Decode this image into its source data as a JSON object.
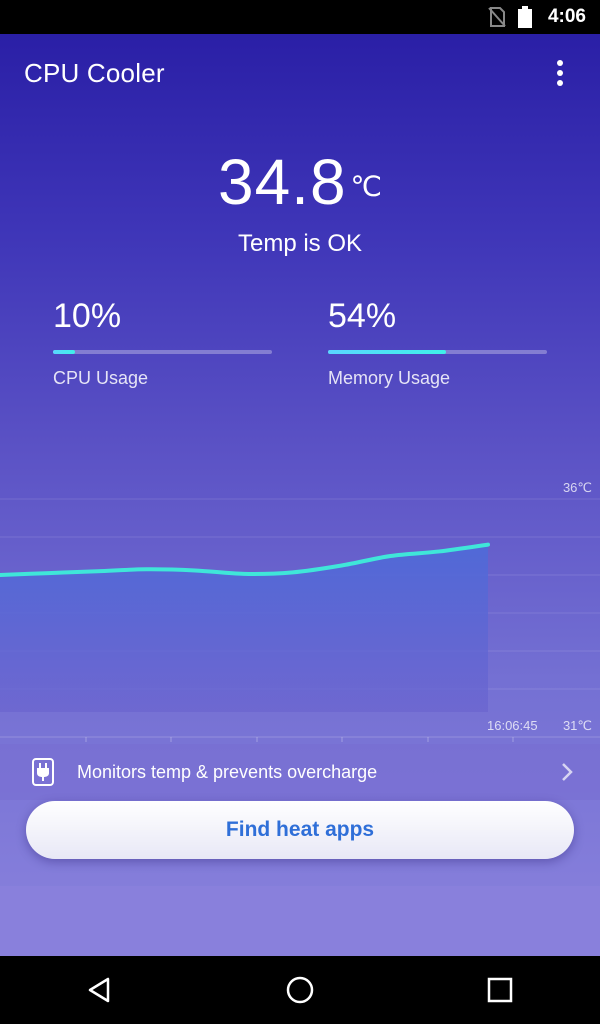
{
  "status_bar": {
    "time": "4:06",
    "icons": [
      "no-sim-icon",
      "battery-icon"
    ]
  },
  "app": {
    "title": "CPU Cooler",
    "menu_icon": "more-vert-icon"
  },
  "temperature": {
    "value": "34.8",
    "unit": "℃",
    "status": "Temp is OK"
  },
  "cpu": {
    "value": "10%",
    "fill_percent": 10,
    "label": "CPU Usage"
  },
  "memory": {
    "value": "54%",
    "fill_percent": 54,
    "label": "Memory Usage"
  },
  "chart_data": {
    "type": "area",
    "title": "",
    "xlabel": "",
    "ylabel": "",
    "y_max_label": "36℃",
    "y_min_label": "31℃",
    "ylim": [
      31,
      36
    ],
    "x_end_label": "16:06:45",
    "values": [
      34.0,
      34.05,
      34.1,
      34.15,
      34.12,
      34.03,
      34.07,
      34.25,
      34.5,
      34.62,
      34.8
    ],
    "grid": true,
    "colors": {
      "line": "#3fe6d9",
      "fill": "#4f6ad8"
    }
  },
  "monitor": {
    "icon": "plug-icon",
    "text": "Monitors temp & prevents overcharge",
    "chevron_icon": "chevron-right-icon"
  },
  "find_button": {
    "label": "Find heat apps"
  },
  "nav": {
    "back_icon": "back-icon",
    "home_icon": "home-icon",
    "recents_icon": "recents-icon"
  }
}
